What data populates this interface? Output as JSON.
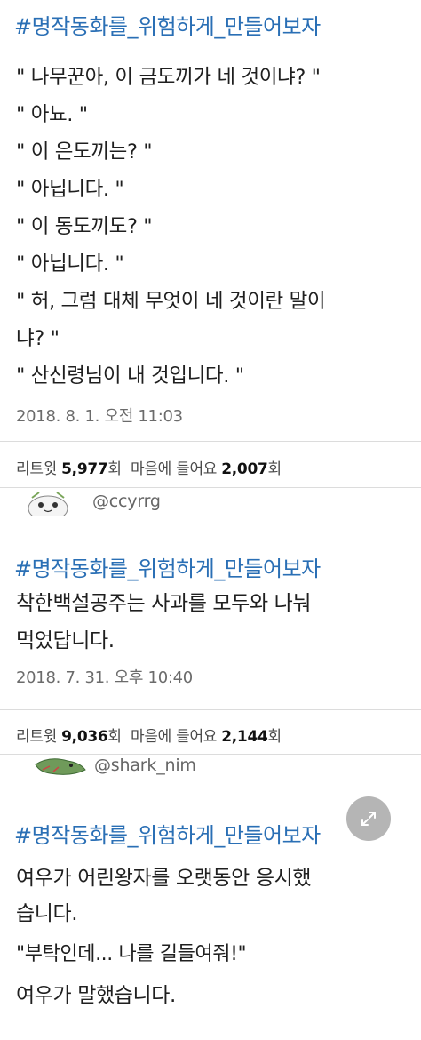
{
  "tweet1": {
    "hashtag": "#명작동화를_위험하게_만들어보자",
    "lines": [
      "\" 나무꾼아, 이 금도끼가 네 것이냐? \"",
      "\" 아뇨. \"",
      "\" 이 은도끼는? \"",
      "\" 아닙니다. \"",
      "\" 이 동도끼도? \"",
      "\" 아닙니다. \"",
      "\" 허, 그럼 대체 무엇이 네 것이란 말이",
      "냐? \"",
      "\" 산신령님이 내 것입니다. \""
    ],
    "timestamp": "2018. 8. 1. 오전 11:03",
    "retweet_label": "리트윗",
    "retweet_count": "5,977",
    "count_unit": "회",
    "like_label": "마음에 들어요",
    "like_count": "2,007"
  },
  "tweet2": {
    "handle": "@ccyrrg",
    "hashtag": "#명작동화를_위험하게_만들어보자",
    "lines": [
      "착한백설공주는 사과를 모두와 나눠",
      "먹었답니다."
    ],
    "timestamp": "2018. 7. 31. 오후 10:40",
    "retweet_label": "리트윗",
    "retweet_count": "9,036",
    "count_unit": "회",
    "like_label": "마음에 들어요",
    "like_count": "2,144"
  },
  "tweet3": {
    "handle": "@shark_nim",
    "hashtag": "#명작동화를_위험하게_만들어보자",
    "lines": [
      "여우가 어린왕자를 오랫동안 응시했",
      "습니다.",
      "\"부탁인데... 나를 길들여줘!\"",
      "여우가 말했습니다."
    ]
  },
  "colors": {
    "hashtag": "#2a6fb5",
    "text": "#1f1f1f",
    "meta": "#6b6b6b"
  },
  "icons": {
    "expand": "expand-arrows-icon",
    "avatar1": "avatar",
    "avatar2": "avatar"
  }
}
